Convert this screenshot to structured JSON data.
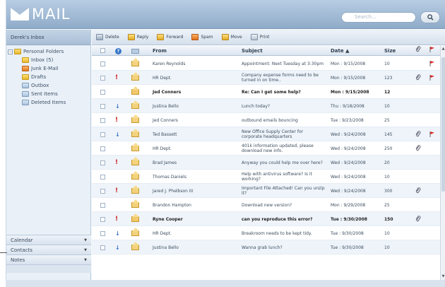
{
  "app": {
    "logo_text": "MAIL"
  },
  "search": {
    "placeholder": "Search..."
  },
  "left": {
    "inbox_header": "Derek's Inbox",
    "root_folder": "Personal Folders",
    "folders": [
      {
        "label": "Inbox (5)",
        "icon": "inbox-folder-icon",
        "color": "yellow"
      },
      {
        "label": "Junk E-Mail",
        "icon": "junk-folder-icon",
        "color": "orange"
      },
      {
        "label": "Drafts",
        "icon": "drafts-folder-icon",
        "color": "yellow"
      },
      {
        "label": "Outbox",
        "icon": "outbox-folder-icon",
        "color": "blue"
      },
      {
        "label": "Sent Items",
        "icon": "sent-folder-icon",
        "color": "blue"
      },
      {
        "label": "Deleted Items",
        "icon": "deleted-folder-icon",
        "color": "blue"
      }
    ],
    "modules": [
      "Calendar",
      "Contacts",
      "Notes"
    ]
  },
  "toolbar": {
    "buttons": [
      {
        "label": "Delete",
        "icon": "trash-icon"
      },
      {
        "label": "Reply",
        "icon": "reply-icon"
      },
      {
        "label": "Forward",
        "icon": "forward-icon"
      },
      {
        "label": "Spam",
        "icon": "spam-icon"
      },
      {
        "label": "Move",
        "icon": "move-icon"
      },
      {
        "label": "Print",
        "icon": "print-icon"
      }
    ]
  },
  "columns": {
    "from": "From",
    "subject": "Subject",
    "date": "Date ▲",
    "size": "Size"
  },
  "colors": {
    "accent": "#8fabc9",
    "flag": "#e02020",
    "priority_high": "#cc2222",
    "priority_low": "#3a6fc8"
  },
  "emails": [
    {
      "from": "Karen Reynolds",
      "subject": "Appointment: Next Tuesday at 3:30pm",
      "date": "Mon : 9/15/2008",
      "size": "10",
      "priority": "",
      "attach": false,
      "flag": true,
      "unread": false
    },
    {
      "from": "HR Dept.",
      "subject": "Company expense forms need to be turned in on time..",
      "date": "Mon : 9/15/2008",
      "size": "123",
      "priority": "high",
      "attach": true,
      "flag": true,
      "unread": false
    },
    {
      "from": "Jed Conners",
      "subject": "Re: Can I get some help?",
      "date": "Mon : 9/15/2008",
      "size": "12",
      "priority": "",
      "attach": false,
      "flag": false,
      "unread": true
    },
    {
      "from": "Justina Bello",
      "subject": "Lunch today?",
      "date": "Thu : 9/18/2008",
      "size": "10",
      "priority": "low",
      "attach": false,
      "flag": false,
      "unread": false
    },
    {
      "from": "Jed Conners",
      "subject": "outbound emails bouncing",
      "date": "Tue : 9/23/2008",
      "size": "25",
      "priority": "high",
      "attach": false,
      "flag": false,
      "unread": false
    },
    {
      "from": "Ted Bassett",
      "subject": "New Office Supply Center for corporate headquarters",
      "date": "Wed : 9/24/2008",
      "size": "145",
      "priority": "low",
      "attach": true,
      "flag": true,
      "unread": false
    },
    {
      "from": "HR Dept.",
      "subject": "401k information updated, please download new info.",
      "date": "Wed : 9/24/2008",
      "size": "250",
      "priority": "",
      "attach": true,
      "flag": false,
      "unread": false
    },
    {
      "from": "Brad James",
      "subject": "Anyway you could help me over here?",
      "date": "Wed : 9/24/2008",
      "size": "20",
      "priority": "high",
      "attach": false,
      "flag": false,
      "unread": false
    },
    {
      "from": "Thomas Daniels",
      "subject": "Help with antivirus software? Is it working?",
      "date": "Wed : 9/24/2008",
      "size": "10",
      "priority": "",
      "attach": false,
      "flag": false,
      "unread": false
    },
    {
      "from": "Jared J. Phelbson III",
      "subject": "Important File Attached! Can you unzip it?",
      "date": "Wed : 9/24/2008",
      "size": "300",
      "priority": "high",
      "attach": true,
      "flag": false,
      "unread": false
    },
    {
      "from": "Brandon Hampton",
      "subject": "Download new version?",
      "date": "Mon : 9/29/2008",
      "size": "25",
      "priority": "",
      "attach": false,
      "flag": false,
      "unread": false
    },
    {
      "from": "Ryne Cooper",
      "subject": "can you reproduce this error?",
      "date": "Tue : 9/30/2008",
      "size": "150",
      "priority": "high",
      "attach": true,
      "flag": false,
      "unread": true
    },
    {
      "from": "HR Dept.",
      "subject": "Breakroom needs to be kept tidy.",
      "date": "Tue : 9/30/2008",
      "size": "10",
      "priority": "low",
      "attach": false,
      "flag": false,
      "unread": false
    },
    {
      "from": "Justina Bello",
      "subject": "Wanna grab lunch?",
      "date": "Tue : 9/30/2008",
      "size": "10",
      "priority": "low",
      "attach": false,
      "flag": false,
      "unread": false
    }
  ]
}
